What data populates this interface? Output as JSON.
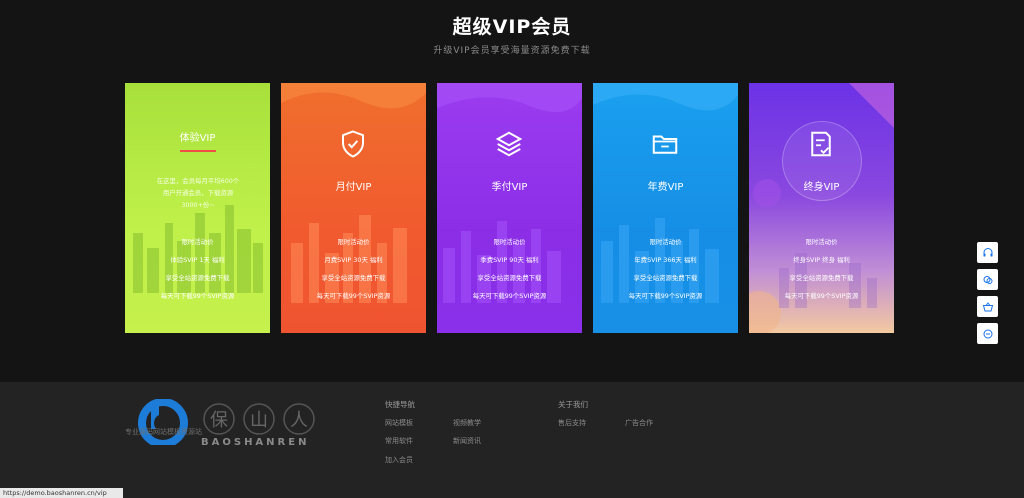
{
  "header": {
    "title": "超级VIP会员",
    "subtitle": "升级VIP会员享受海量资源免费下载"
  },
  "colors": {
    "background": "#141414",
    "footer": "#232323",
    "accent_underline": "#ef4d45",
    "logo_blue": "#1c7cd8"
  },
  "cards": [
    {
      "name": "体验VIP",
      "icon": "none",
      "description": [
        "在这里，会员每月平均600个",
        "用户开通会员，下载资源",
        "3000+份~"
      ],
      "features": [
        "限时活动价",
        "体验SVIP 1天 福利",
        "享受全站资源免费下载",
        "每天可下载99个SVIP资源"
      ]
    },
    {
      "name": "月付VIP",
      "icon": "shield-check-icon",
      "features": [
        "限时活动价",
        "月费SVIP 30天 福利",
        "享受全站资源免费下载",
        "每天可下载99个SVIP资源"
      ]
    },
    {
      "name": "季付VIP",
      "icon": "layers-icon",
      "features": [
        "限时活动价",
        "季费SVIP 90天 福利",
        "享受全站资源免费下载",
        "每天可下载99个SVIP资源"
      ]
    },
    {
      "name": "年费VIP",
      "icon": "folder-icon",
      "features": [
        "限时活动价",
        "年费SVIP 366天 福利",
        "享受全站资源免费下载",
        "每天可下载99个SVIP资源"
      ]
    },
    {
      "name": "终身VIP",
      "icon": "document-check-icon",
      "features": [
        "限时活动价",
        "终身SVIP 终身 福利",
        "享受全站资源免费下载",
        "每天可下载99个SVIP资源"
      ]
    }
  ],
  "footer": {
    "logo_cn": "保山人",
    "logo_en": "BAOSHANREN",
    "logo_caption": "专业源码网站模板资源站",
    "quick_nav": {
      "heading": "快捷导航",
      "links": [
        "网站模板",
        "视频教学",
        "常用软件",
        "新闻资讯",
        "加入会员"
      ]
    },
    "about": {
      "heading": "关于我们",
      "links": [
        "售后支持",
        "广告合作"
      ]
    }
  },
  "sidebar": {
    "icons": [
      "headset-icon",
      "chat-icon",
      "basket-icon",
      "message-icon"
    ]
  },
  "status_bar": {
    "url": "https://demo.baoshanren.cn/vip"
  }
}
